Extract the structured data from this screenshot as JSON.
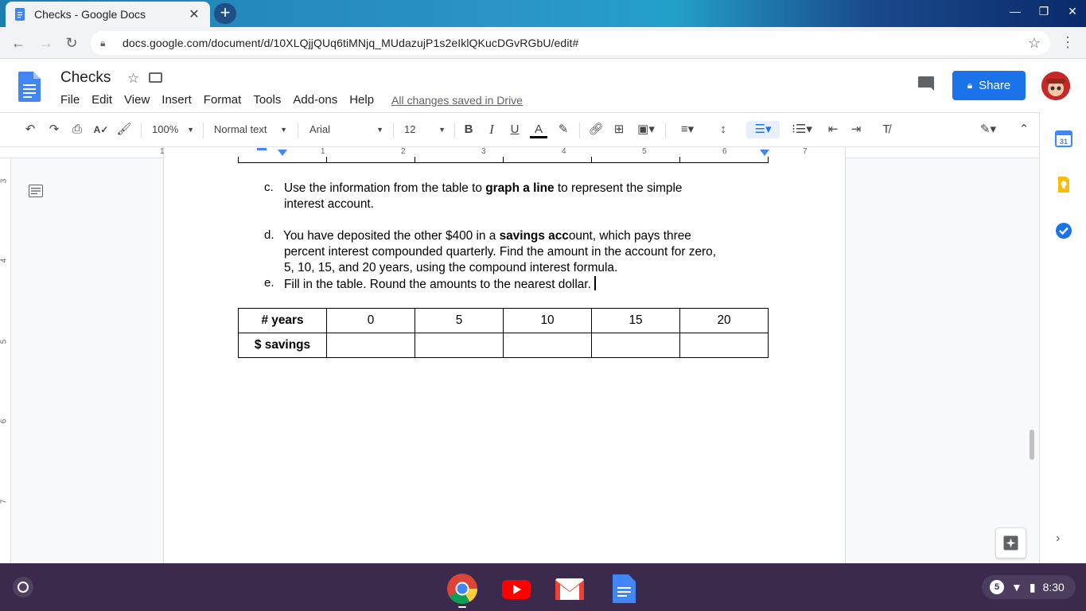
{
  "browser": {
    "tab_title": "Checks - Google Docs",
    "url": "docs.google.com/document/d/10XLQjjQUq6tiMNjq_MUdazujP1s2eIklQKucDGvRGbU/edit#"
  },
  "docs": {
    "title": "Checks",
    "menu": [
      "File",
      "Edit",
      "View",
      "Insert",
      "Format",
      "Tools",
      "Add-ons",
      "Help"
    ],
    "save_status": "All changes saved in Drive",
    "share_label": "Share"
  },
  "toolbar": {
    "zoom": "100%",
    "style": "Normal text",
    "font": "Arial",
    "size": "12"
  },
  "ruler": {
    "h_numbers": [
      "1",
      "1",
      "2",
      "3",
      "4",
      "5",
      "6",
      "7"
    ],
    "v_numbers": [
      "3",
      "4",
      "5",
      "6",
      "7"
    ]
  },
  "document": {
    "item_c": {
      "marker": "c.",
      "pre": "Use the information from the table to ",
      "bold": "graph a line",
      "post": " to represent the simple",
      "line2": "interest account."
    },
    "item_d": {
      "marker": "d.",
      "pre": "You have deposited the other $400 in a ",
      "bold": "savings acc",
      "post": "ount, which pays three",
      "line2": "percent interest compounded quarterly. Find the amount in the account for zero,",
      "line3": "5, 10, 15, and 20 years, using the compound interest formula."
    },
    "item_e": {
      "marker": "e.",
      "text": "Fill in the table. Round the amounts to the nearest dollar."
    },
    "table": {
      "header": [
        "# years",
        "0",
        "5",
        "10",
        "15",
        "20"
      ],
      "row": [
        "$ savings",
        "",
        "",
        "",
        "",
        ""
      ]
    }
  },
  "shelf": {
    "notification_count": "5",
    "time": "8:30"
  },
  "colors": {
    "accent": "#1a73e8",
    "shelf": "#3b2a4b",
    "docs_blue": "#4285f4"
  }
}
